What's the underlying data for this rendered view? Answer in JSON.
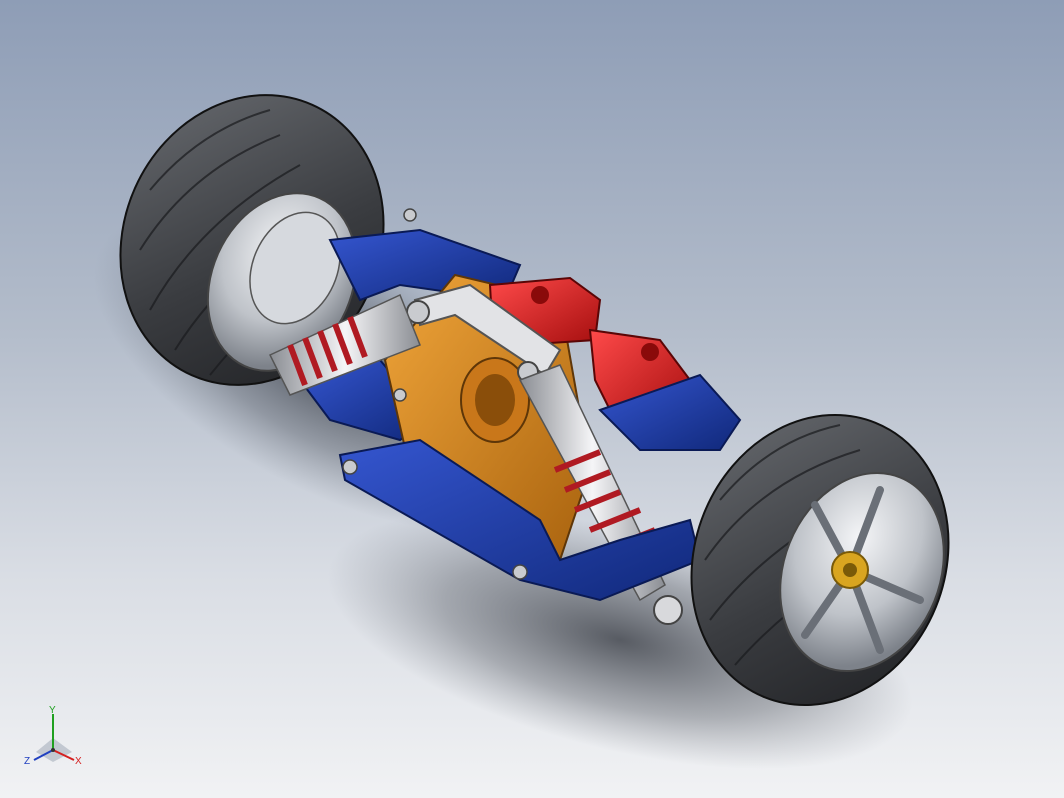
{
  "viewport": {
    "background_top": "#8e9db6",
    "background_bottom": "#f1f2f4"
  },
  "model": {
    "parts": [
      "tire-left",
      "wheel-left",
      "tire-right",
      "wheel-right",
      "chassis",
      "suspension-arms",
      "shock-absorbers",
      "hub-carriers",
      "top-link"
    ],
    "colors": {
      "tire": "#3a3c40",
      "rim": "#bfc3c9",
      "arm": "#1f3fa8",
      "chassis": "#d98a1c",
      "hub": "#e01e1e",
      "spring": "#b01a22",
      "shock_body": "#d8d8da"
    }
  },
  "triad": {
    "x_label": "X",
    "y_label": "Y",
    "z_label": "Z",
    "x_color": "#d42020",
    "y_color": "#20a020",
    "z_color": "#2040c0"
  }
}
